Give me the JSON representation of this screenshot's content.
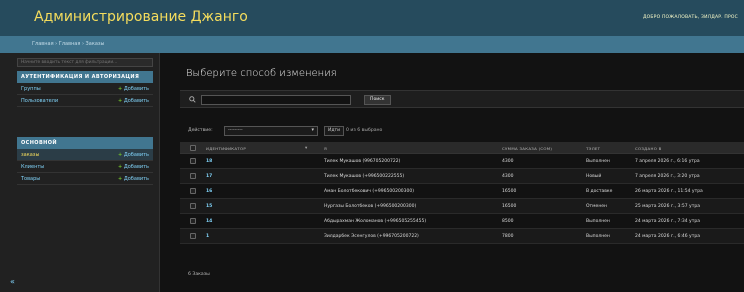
{
  "header": {
    "brand": "Администрирование Джанго",
    "user_tools": "ДОБРО ПОЖАЛОВАТЬ, ЗИЛДАР. ПРОС"
  },
  "breadcrumbs": "Главная › Главная › Заказы",
  "sidebar": {
    "filter_placeholder": "Начните вводить текст для фильтрации...",
    "modules": [
      {
        "caption": "АУТЕНТИФИКАЦИЯ И АВТОРИЗАЦИЯ",
        "items": [
          {
            "name": "Группы",
            "add": "Добавить"
          },
          {
            "name": "Пользователи",
            "add": "Добавить"
          }
        ]
      },
      {
        "caption": "ОСНОВНОЙ",
        "items": [
          {
            "name": "заказы",
            "add": "Добавить"
          },
          {
            "name": "Клиенты",
            "add": "Добавить"
          },
          {
            "name": "Товары",
            "add": "Добавить"
          }
        ]
      }
    ],
    "collapse": "«"
  },
  "main": {
    "title": "Выберите способ изменения",
    "search_value": "",
    "search_button": "Поиск",
    "actions_label": "Действие:",
    "action_select": "---------",
    "go_button": "Идти",
    "action_counter": "0 из 6 выбрано",
    "columns": [
      "ИДЕНТИФИКАТОР",
      "Я",
      "СУММА ЗАКАЗА (СОМ)",
      "ТЭЛЕТ",
      "СОЗДАНО В"
    ],
    "rows": [
      {
        "id": "18",
        "name": "Тилек Мукашов (996705200722)",
        "sum": "4300",
        "status": "Выполнен",
        "date": "7 апреля 2026 г., 6:16 утра"
      },
      {
        "id": "17",
        "name": "Тилек Мукашов (+996500222555)",
        "sum": "4300",
        "status": "Новый",
        "date": "7 апреля 2026 г., 3:20 утра"
      },
      {
        "id": "16",
        "name": "Аман Болотбекович (+996500200300)",
        "sum": "16500",
        "status": "В доставке",
        "date": "26 марта 2026 г., 11:54 утра"
      },
      {
        "id": "15",
        "name": "Нургазы Болотбеков (+996500200300)",
        "sum": "16500",
        "status": "Отменен",
        "date": "25 марта 2026 г., 3:57 утра"
      },
      {
        "id": "14",
        "name": "Абдырахман Жоломанов (+996505255455)",
        "sum": "8500",
        "status": "Выполнен",
        "date": "24 марта 2026 г., 7:34 утра"
      },
      {
        "id": "1",
        "name": "Зилдарбек Эсенгулов (+996705200722)",
        "sum": "7800",
        "status": "Выполнен",
        "date": "24 марта 2026 г., 6:46 утра"
      }
    ],
    "paginator": "6 Заказы"
  }
}
